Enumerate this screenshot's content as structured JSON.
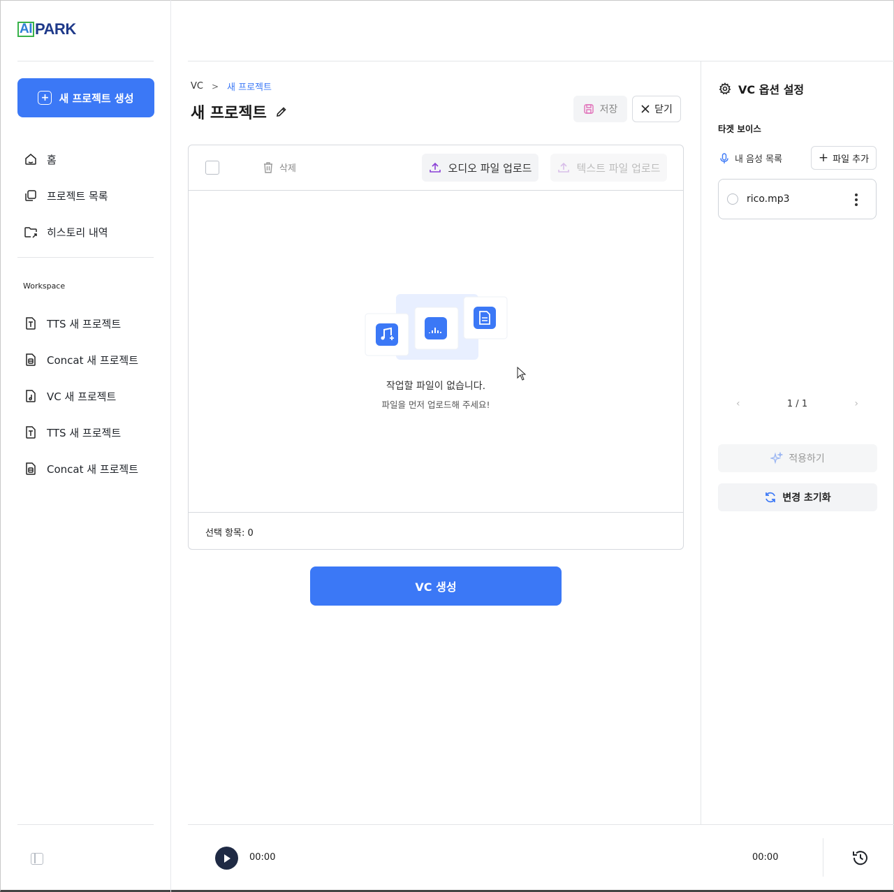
{
  "brand": {
    "logo_ai": "AI",
    "logo_park": "PARK"
  },
  "sidebar": {
    "new_project_label": "새 프로젝트 생성",
    "nav": [
      {
        "label": "홈",
        "icon": "home-icon"
      },
      {
        "label": "프로젝트 목록",
        "icon": "copy-icon"
      },
      {
        "label": "히스토리 내역",
        "icon": "folder-link-icon"
      }
    ],
    "workspace_label": "Workspace",
    "workspace_items": [
      {
        "label": "TTS 새 프로젝트",
        "icon": "file-text-icon"
      },
      {
        "label": "Concat 새 프로젝트",
        "icon": "file-concat-icon"
      },
      {
        "label": "VC 새 프로젝트",
        "icon": "file-music-icon"
      },
      {
        "label": "TTS 새 프로젝트",
        "icon": "file-text-icon"
      },
      {
        "label": "Concat 새 프로젝트",
        "icon": "file-concat-icon"
      }
    ]
  },
  "breadcrumb": {
    "root": "VC",
    "separator": ">",
    "current": "새 프로젝트"
  },
  "page": {
    "title": "새 프로젝트",
    "save_label": "저장",
    "close_label": "닫기"
  },
  "file_panel": {
    "delete_label": "삭제",
    "audio_upload_label": "오디오 파일 업로드",
    "text_upload_label": "텍스트 파일 업로드",
    "empty_title": "작업할 파일이 없습니다.",
    "empty_subtitle": "파일을 먼저 업로드해 주세요!",
    "selected_count_label": "선택 항목: 0"
  },
  "vc_generate_label": "VC 생성",
  "player": {
    "current_time": "00:00",
    "total_time": "00:00"
  },
  "options": {
    "title": "VC 옵션 설정",
    "target_voice_label": "타겟 보이스",
    "my_voice_list_label": "내 음성 목록",
    "add_file_label": "파일 추가",
    "voices": [
      {
        "name": "rico.mp3"
      }
    ],
    "pagination": "1 / 1",
    "apply_label": "적용하기",
    "reset_label": "변경 초기화"
  },
  "colors": {
    "accent": "#3b78f6",
    "player_dark": "#1f2a44"
  }
}
